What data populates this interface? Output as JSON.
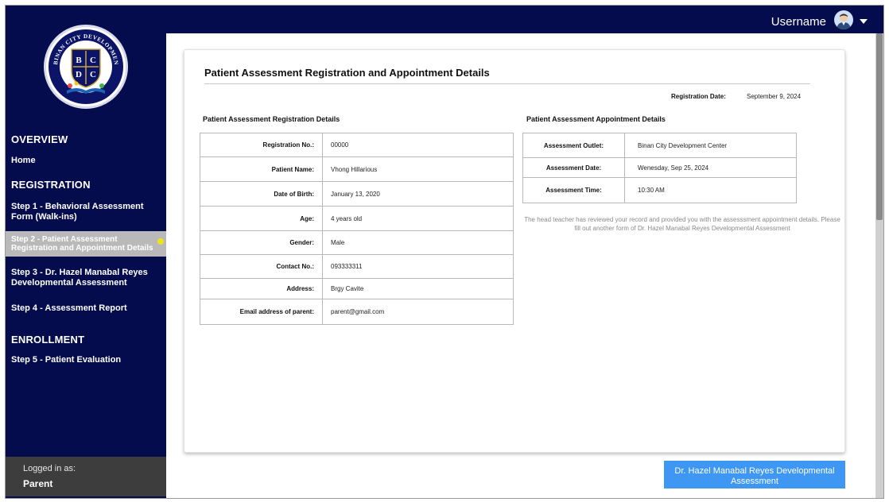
{
  "sidebar": {
    "logo": {
      "text": "BINAN CITY DEVELOPMENT CENTER",
      "initials": [
        "B",
        "C",
        "D",
        "C"
      ]
    },
    "sections": [
      {
        "label": "OVERVIEW",
        "items": [
          "Home"
        ]
      },
      {
        "label": "REGISTRATION",
        "items": [
          "Step 1 - Behavioral Assessment Form (Walk-ins)",
          "Step 2 - Patient Assessment Registration and Appointment Details",
          "Step 3 - Dr. Hazel Manabal Reyes Developmental Assessment",
          "Step 4 - Assessment Report"
        ]
      },
      {
        "label": "ENROLLMENT",
        "items": [
          "Step 5 - Patient Evaluation"
        ]
      }
    ],
    "logged_in_label": "Logged in as:",
    "logged_in_role": "Parent"
  },
  "topbar": {
    "username": "Username",
    "avatar_icon": "user-avatar-icon",
    "menu_icon": "caret-down-icon"
  },
  "colors": {
    "nav": "#050c4e",
    "accent": "#3d97f3",
    "active_dot": "#f2e21b",
    "active_item": "#b9b9b9"
  },
  "card": {
    "title": "Patient Assessment Registration and Appointment Details",
    "registration_date_label": "Registration Date:",
    "registration_date": "September 9, 2024",
    "registration_section_title": "Patient Assessment Registration Details",
    "registration_rows": [
      {
        "label": "Registration No.:",
        "value": "00000"
      },
      {
        "label": "Patient Name:",
        "value": "Vhong Hillarious"
      },
      {
        "label": "Date of Birth:",
        "value": "January 13, 2020"
      },
      {
        "label": "Age:",
        "value": "4 years old"
      },
      {
        "label": "Gender:",
        "value": "Male"
      },
      {
        "label": "Contact No.:",
        "value": "093333311"
      },
      {
        "label": "Address:",
        "value": "Brgy Cavite"
      },
      {
        "label": "Email address of  parent:",
        "value": "parent@gmail.com"
      }
    ],
    "appointment_section_title": "Patient Assessment Appointment Details",
    "appointment_rows": [
      {
        "label": "Assessment Outlet:",
        "value": "Binan City Development Center"
      },
      {
        "label": "Assessment Date:",
        "value": "Wenesday, Sep 25, 2024"
      },
      {
        "label": "Assessment Time:",
        "value": "10:30 AM"
      }
    ],
    "note": "The head teacher has reviewed your record and provided you with the assesssment appointment details. Please fill out another form of Dr. Hazel Manabal Reyes  Developmental Assessment"
  },
  "next_button": "Dr. Hazel Manabal Reyes  Developmental Assessment"
}
